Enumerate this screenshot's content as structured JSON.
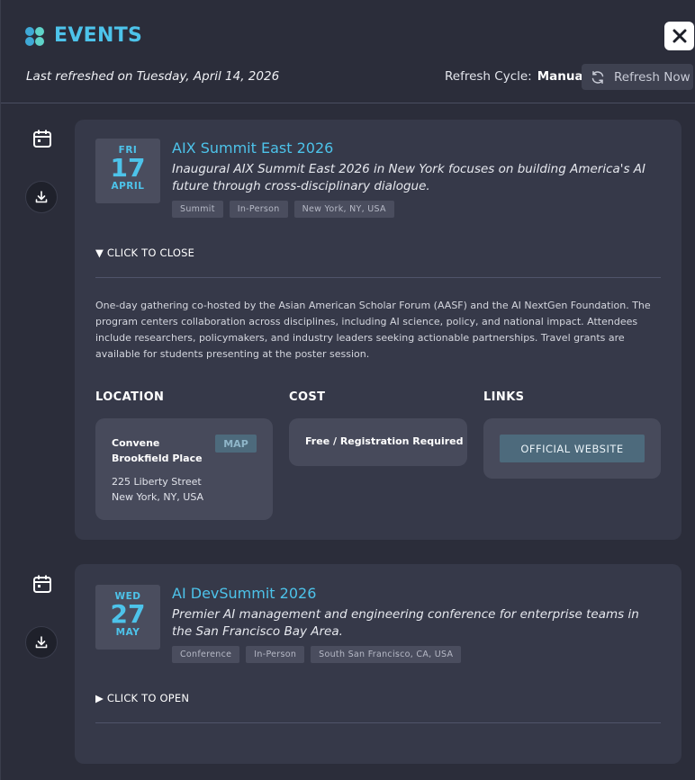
{
  "header": {
    "title": "EVENTS",
    "last_refreshed": "Last refreshed on Tuesday, April 14, 2026",
    "cycle_label": "Refresh Cycle:",
    "cycle_value": "Manual",
    "refresh_label": "Refresh Now"
  },
  "events": [
    {
      "dow": "FRI",
      "day": "17",
      "month": "APRIL",
      "title": "AIX Summit East 2026",
      "description": "Inaugural AIX Summit East 2026 in New York focuses on building America's AI future through cross-disciplinary dialogue.",
      "tags": [
        "Summit",
        "In-Person",
        "New York, NY, USA"
      ],
      "toggle": "▼ CLICK TO CLOSE",
      "details": "One-day gathering co-hosted by the Asian American Scholar Forum (AASF) and the AI NextGen Foundation. The program centers collaboration across disciplines, including AI science, policy, and national impact. Attendees include researchers, policymakers, and industry leaders seeking actionable partnerships. Travel grants are available for students presenting at the poster session.",
      "location_heading": "LOCATION",
      "cost_heading": "COST",
      "links_heading": "LINKS",
      "venue": "Convene Brookfield Place",
      "map_label": "MAP",
      "address_line1": "225 Liberty Street",
      "address_line2": "New York, NY, USA",
      "cost": "Free / Registration Required",
      "website_label": "OFFICIAL WEBSITE"
    },
    {
      "dow": "WED",
      "day": "27",
      "month": "MAY",
      "title": "AI DevSummit 2026",
      "description": "Premier AI management and engineering conference for enterprise teams in the San Francisco Bay Area.",
      "tags": [
        "Conference",
        "In-Person",
        "South San Francisco, CA, USA"
      ],
      "toggle": "▶ CLICK TO OPEN"
    }
  ],
  "colors": {
    "accent": "#4dc3ea",
    "background": "#2b2d3a",
    "card": "#363949",
    "button": "#4d6a7c"
  },
  "icons": {
    "logo": "dots-logo-icon",
    "close": "close-icon",
    "refresh": "refresh-icon",
    "calendar": "calendar-icon",
    "download": "download-icon"
  }
}
